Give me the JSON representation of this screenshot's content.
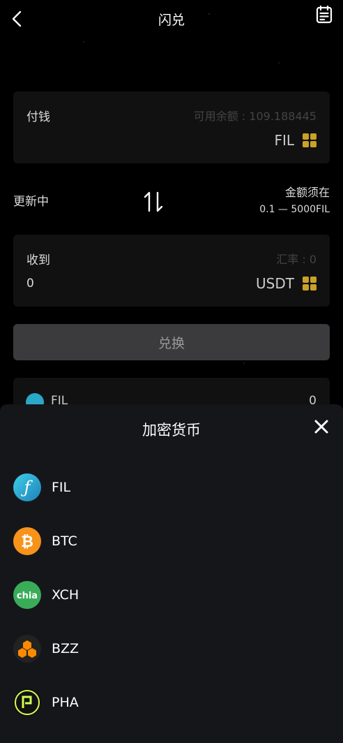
{
  "header": {
    "title": "闪兑",
    "back_icon": "chevron-left-icon",
    "record_icon": "document-list-icon"
  },
  "pay": {
    "label": "付钱",
    "balance": "可用余额 : 109.188445",
    "currency": "FIL",
    "currency_icon": "grid-icon"
  },
  "status": {
    "updating": "更新中",
    "limit_title": "金额须在",
    "limit_range": "0.1 — 5000FIL",
    "swap_icon": "swap-vertical-icon"
  },
  "receive": {
    "label": "收到",
    "rate": "汇率 : 0",
    "amount": "0",
    "currency": "USDT",
    "currency_icon": "grid-icon"
  },
  "exchange_button": "兑换",
  "asset": {
    "name": "FIL",
    "value": "0"
  },
  "sheet": {
    "title": "加密货币",
    "close_icon": "close-icon",
    "coins": [
      {
        "name": "FIL",
        "icon": "fil-icon",
        "color": "#2aa7c9"
      },
      {
        "name": "BTC",
        "icon": "btc-icon",
        "color": "#f7931a"
      },
      {
        "name": "XCH",
        "icon": "chia-icon",
        "color": "#3aac59"
      },
      {
        "name": "BZZ",
        "icon": "bzz-icon",
        "color": "#ff8a00"
      },
      {
        "name": "PHA",
        "icon": "pha-icon",
        "color": "#d1ff52"
      }
    ]
  },
  "colors": {
    "accent_gold": "#c9a227",
    "sheet_bg": "#15161a",
    "card_bg": "#111112"
  }
}
